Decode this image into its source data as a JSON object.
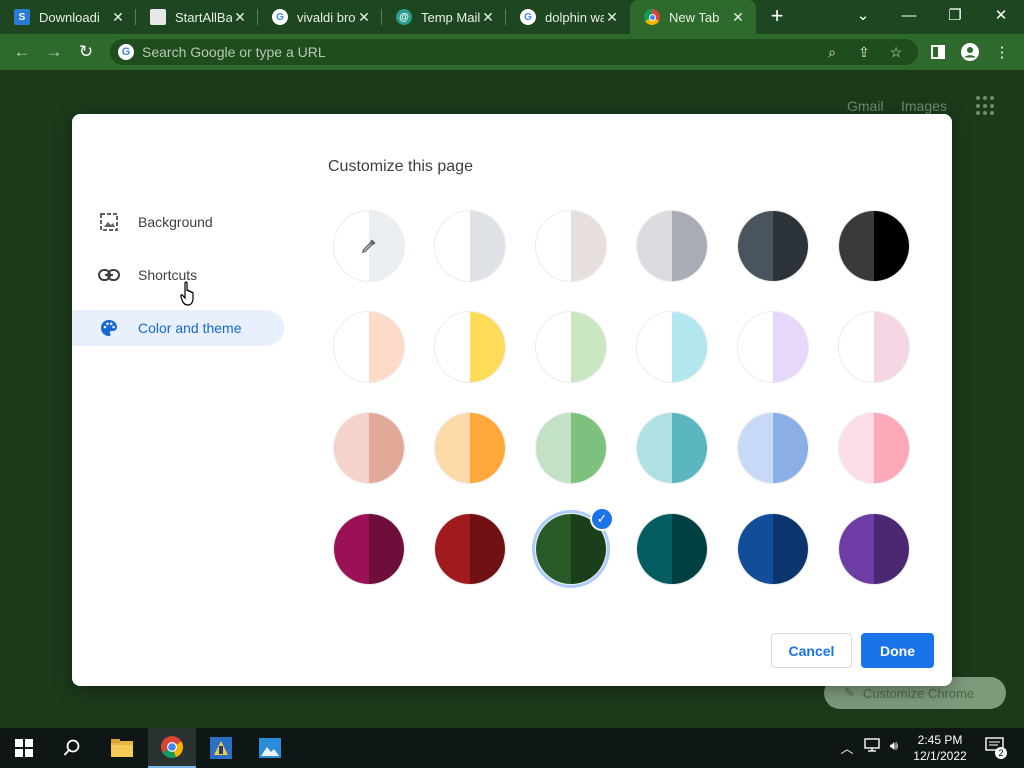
{
  "browser": {
    "tabs": [
      {
        "title": "Downloadi",
        "icon": "downloads-site-icon",
        "color": "#2a7ad6",
        "active": false
      },
      {
        "title": "StartAllBack",
        "icon": "startallback-icon",
        "color": "#f0f0f0",
        "active": false
      },
      {
        "title": "vivaldi brov",
        "icon": "google-icon",
        "color": "#ffffff",
        "active": false
      },
      {
        "title": "Temp Mail",
        "icon": "tempmail-icon",
        "color": "#2a9d8f",
        "active": false
      },
      {
        "title": "dolphin wa",
        "icon": "google-icon",
        "color": "#ffffff",
        "active": false
      },
      {
        "title": "New Tab",
        "icon": "chrome-icon",
        "color": "#ffffff",
        "active": true
      }
    ],
    "omnibox": {
      "placeholder": "Search Google or type a URL"
    }
  },
  "ntp": {
    "gmail": "Gmail",
    "images": "Images",
    "customize_chrome": "Customize Chrome"
  },
  "dialog": {
    "title": "Customize this page",
    "nav": [
      {
        "label": "Background",
        "icon": "image-icon",
        "selected": false
      },
      {
        "label": "Shortcuts",
        "icon": "link-icon",
        "selected": false
      },
      {
        "label": "Color and theme",
        "icon": "palette-icon",
        "selected": true
      }
    ],
    "swatches": [
      {
        "left": "#ffffff",
        "right": "#eceff1",
        "custom": true
      },
      {
        "left": "#ffffff",
        "right": "#dee1e6"
      },
      {
        "left": "#ffffff",
        "right": "#e6dfdc"
      },
      {
        "left": "#dadce0",
        "right": "#a9acb4"
      },
      {
        "left": "#49545f",
        "right": "#2c3339"
      },
      {
        "left": "#3a3a3a",
        "right": "#000000"
      },
      {
        "left": "#ffffff",
        "right": "#fddbc8"
      },
      {
        "left": "#ffffff",
        "right": "#fedc5a"
      },
      {
        "left": "#ffffff",
        "right": "#c9e8c1"
      },
      {
        "left": "#ffffff",
        "right": "#b2e7f0"
      },
      {
        "left": "#ffffff",
        "right": "#e6d7fb"
      },
      {
        "left": "#ffffff",
        "right": "#f6d6e5"
      },
      {
        "left": "#f4d3ca",
        "right": "#e3a898"
      },
      {
        "left": "#fed9a9",
        "right": "#fda83a"
      },
      {
        "left": "#c3e1c5",
        "right": "#7cc17e"
      },
      {
        "left": "#b1e0e2",
        "right": "#5ab7be"
      },
      {
        "left": "#c7d9f6",
        "right": "#8aaee5"
      },
      {
        "left": "#fddde5",
        "right": "#fba8b8"
      },
      {
        "left": "#9c1155",
        "right": "#6e0e3a"
      },
      {
        "left": "#a01a1e",
        "right": "#701214"
      },
      {
        "left": "#275a27",
        "right": "#1b3f1b",
        "selected": true
      },
      {
        "left": "#035d61",
        "right": "#003f42"
      },
      {
        "left": "#124d9a",
        "right": "#0c356d"
      },
      {
        "left": "#6d3ca4",
        "right": "#4b2972"
      }
    ],
    "cancel": "Cancel",
    "done": "Done"
  },
  "taskbar": {
    "time": "2:45 PM",
    "date": "12/1/2022",
    "notifications": "2"
  }
}
